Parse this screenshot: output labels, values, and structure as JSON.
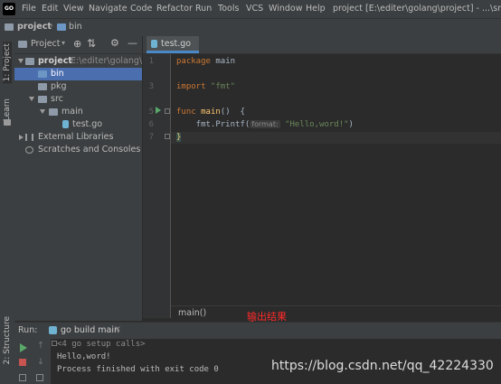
{
  "app_logo": "GO",
  "menu": [
    "File",
    "Edit",
    "View",
    "Navigate",
    "Code",
    "Refactor",
    "Run",
    "Tools",
    "VCS",
    "Window",
    "Help"
  ],
  "window_title": "project [E:\\editer\\golang\\project] - ...\\src\\test",
  "breadcrumb": [
    "project",
    "bin"
  ],
  "left_strip": {
    "project_tab": "1: Project",
    "learn_tab": "Learn",
    "structure_tab": "2: Structure"
  },
  "project_panel": {
    "dropdown_label": "Project",
    "tree": [
      {
        "label": "project",
        "path": "E:\\editer\\golang\\pr"
      },
      {
        "label": "bin"
      },
      {
        "label": "pkg"
      },
      {
        "label": "src"
      },
      {
        "label": "main"
      },
      {
        "label": "test.go"
      },
      {
        "label": "External Libraries"
      },
      {
        "label": "Scratches and Consoles"
      }
    ]
  },
  "editor": {
    "tab_label": "test.go",
    "line_numbers": [
      "1",
      "2",
      "3",
      "4",
      "5",
      "6",
      "7"
    ],
    "code": {
      "l1_kw": "package",
      "l1_rest": " main",
      "l3_kw": "import",
      "l3_str": " \"fmt\"",
      "l5_kw": "func",
      "l5_fn": " main",
      "l5_rest": "()  {",
      "l6_a": "    fmt.Printf(",
      "l6_hint": "format:",
      "l6_str": " \"Hello,word!\"",
      "l6_b": ")",
      "l7": "}"
    },
    "bottom_breadcrumb": "main()"
  },
  "run_panel": {
    "label": "Run:",
    "config": "go build main",
    "lines": [
      "<4 go setup calls>",
      "Hello,word!",
      "Process finished with exit code 0"
    ]
  },
  "annotation": "输出结果",
  "watermark": "https://blog.csdn.net/qq_42224330",
  "colors": {
    "accent": "#4a88c7",
    "selection": "#4b6eaf",
    "keyword": "#cc7832",
    "string": "#6a8759",
    "annotation": "#ff2a2a"
  }
}
